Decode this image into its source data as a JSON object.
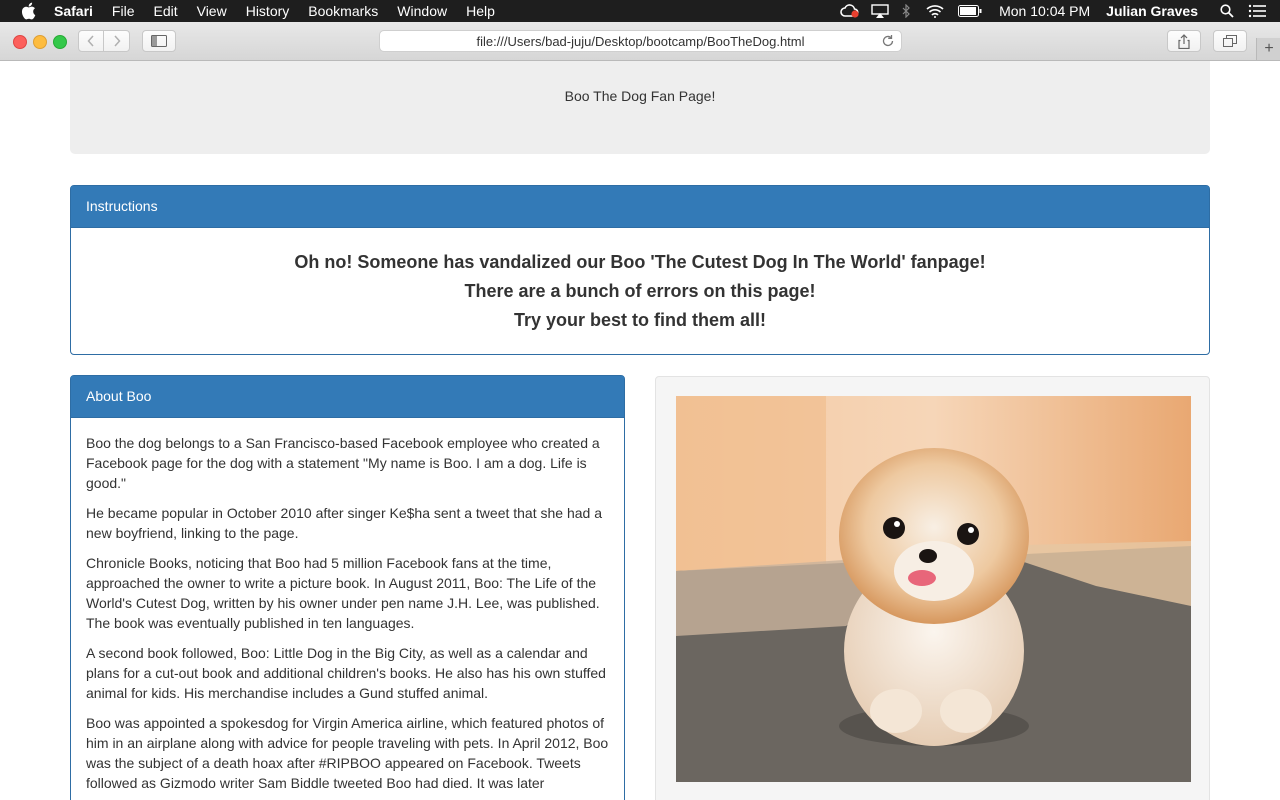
{
  "menubar": {
    "app_name": "Safari",
    "menus": [
      "File",
      "Edit",
      "View",
      "History",
      "Bookmarks",
      "Window",
      "Help"
    ],
    "clock": "Mon 10:04 PM",
    "user": "Julian Graves"
  },
  "browser": {
    "url": "file:///Users/bad-juju/Desktop/bootcamp/BooTheDog.html"
  },
  "page": {
    "jumbotron_title": "Boo The Dog Fan Page!",
    "instructions": {
      "heading": "Instructions",
      "lines": [
        "Oh no! Someone has vandalized our Boo 'The Cutest Dog In The World' fanpage!",
        "There are a bunch of errors on this page!",
        "Try your best to find them all!"
      ]
    },
    "about": {
      "heading": "About Boo",
      "paragraphs": [
        "Boo the dog belongs to a San Francisco-based Facebook employee who created a Facebook page for the dog with a statement \"My name is Boo. I am a dog. Life is good.\"",
        "He became popular in October 2010 after singer Ke$ha sent a tweet that she had a new boyfriend, linking to the page.",
        "Chronicle Books, noticing that Boo had 5 million Facebook fans at the time, approached the owner to write a picture book. In August 2011, Boo: The Life of the World's Cutest Dog, written by his owner under pen name J.H. Lee, was published. The book was eventually published in ten languages.",
        "A second book followed, Boo: Little Dog in the Big City, as well as a calendar and plans for a cut-out book and additional children's books. He also has his own stuffed animal for kids. His merchandise includes a Gund stuffed animal.",
        "Boo was appointed a spokesdog for Virgin America airline, which featured photos of him in an airplane along with advice for people traveling with pets. In April 2012, Boo was the subject of a death hoax after #RIPBOO appeared on Facebook. Tweets followed as Gizmodo writer Sam Biddle tweeted Boo had died. It was later"
      ]
    }
  }
}
